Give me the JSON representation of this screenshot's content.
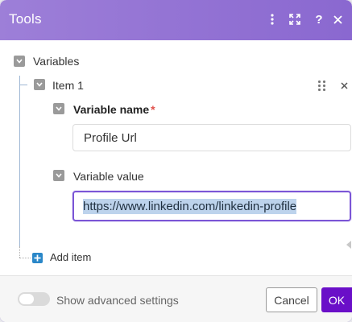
{
  "header": {
    "title": "Tools",
    "icons": [
      "more-vertical-icon",
      "expand-icon",
      "help-icon",
      "close-icon"
    ],
    "gradient": [
      "#9d7fd8",
      "#8a68d0"
    ]
  },
  "variables": {
    "label": "Variables",
    "item": {
      "label": "Item 1",
      "name_field": {
        "label": "Variable name",
        "required_mark": "*",
        "value": "Profile Url"
      },
      "value_field": {
        "label": "Variable value",
        "value": "https://www.linkedin.com/linkedin-profile"
      }
    },
    "add_item_label": "Add item"
  },
  "footer": {
    "advanced_label": "Show advanced settings",
    "advanced_enabled": false,
    "cancel_label": "Cancel",
    "ok_label": "OK"
  },
  "colors": {
    "accent": "#6a0fc8",
    "focus_border": "#7b55d6",
    "add_button": "#2a87c8",
    "required": "#e0504a"
  }
}
